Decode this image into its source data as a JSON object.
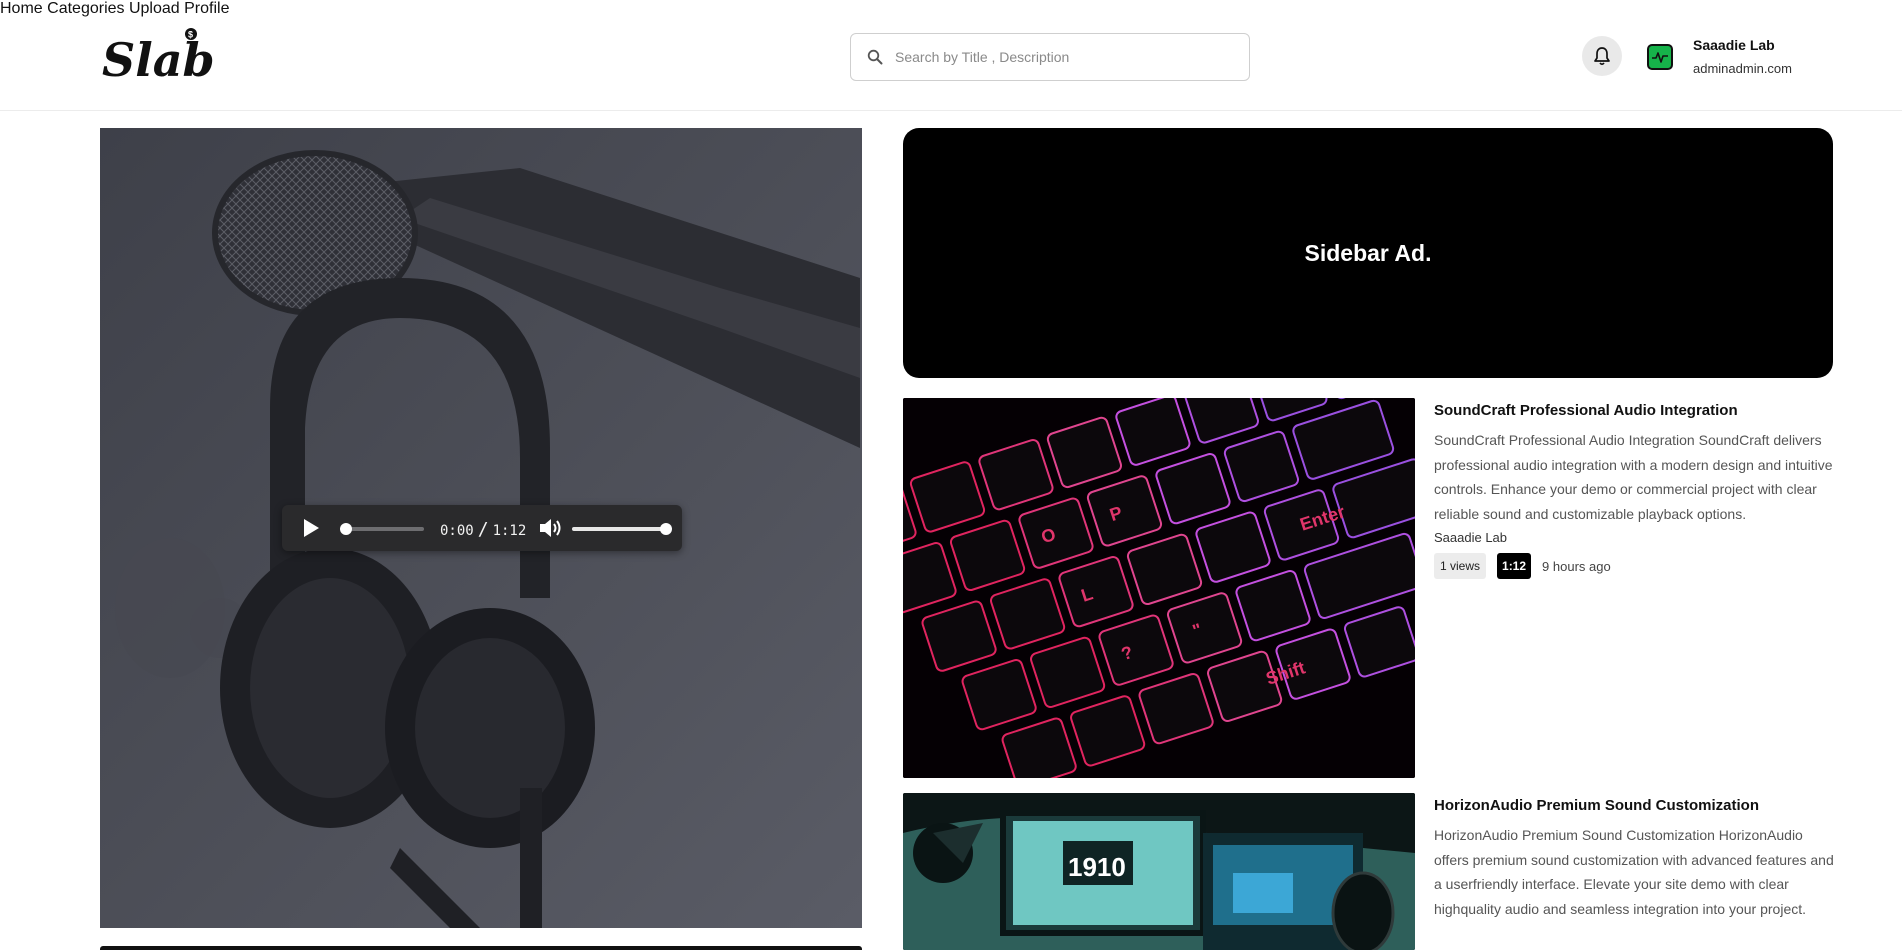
{
  "header": {
    "logo_text": "Slab",
    "search": {
      "placeholder": "Search by Title , Description",
      "value": ""
    },
    "nav": [
      {
        "label": "Home"
      },
      {
        "label": "Categories"
      },
      {
        "label": "Upload"
      },
      {
        "label": "Profile"
      }
    ],
    "user": {
      "name": "Saaadie Lab",
      "email": "adminadmin.com"
    }
  },
  "player": {
    "current_time": "0:00",
    "duration": "1:12",
    "progress_fraction": 0,
    "volume_fraction": 1
  },
  "sidebar": {
    "ad_label": "Sidebar Ad.",
    "videos": [
      {
        "title": "SoundCraft Professional Audio Integration",
        "description": "SoundCraft Professional Audio Integration SoundCraft delivers professional audio integration with a modern design and intuitive controls. Enhance your demo or commercial project with clear reliable sound and customizable playback options.",
        "author": "Saaadie Lab",
        "views": "1 views",
        "duration": "1:12",
        "uploaded": "9 hours ago"
      },
      {
        "title": "HorizonAudio Premium Sound Customization",
        "description": "HorizonAudio Premium Sound Customization HorizonAudio offers premium sound customization with advanced features and a userfriendly interface. Elevate your site demo with clear highquality audio and seamless integration into your project."
      }
    ]
  },
  "colors": {
    "accent_green": "#16b34a",
    "ad_background": "#000000",
    "keyboard_glow": "#ff2a6d"
  },
  "thumb_texts": {
    "monitor_time": "1910"
  }
}
